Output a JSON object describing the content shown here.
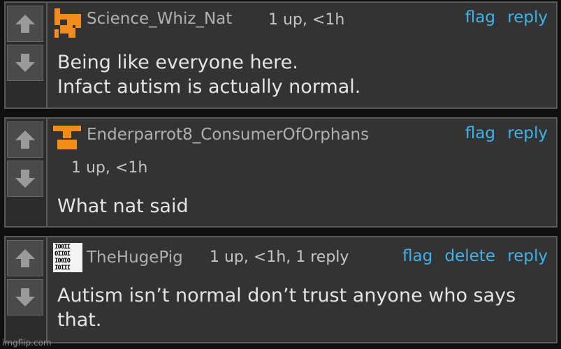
{
  "comments": [
    {
      "username": "Science_Whiz_Nat",
      "meta": "1 up, <1h",
      "flag_label": "flag",
      "reply_label": "reply",
      "text_lines": [
        "Being like everyone here.",
        "Infact autism is actually normal."
      ],
      "avatar_icon": "orange-pixel-avatar-icon"
    },
    {
      "username": "Enderparrot8_ConsumerOfOrphans",
      "meta": "1 up, <1h",
      "flag_label": "flag",
      "reply_label": "reply",
      "text_lines": [
        "What nat said"
      ],
      "avatar_icon": "orange-pixel-avatar-icon"
    },
    {
      "username": "TheHugePig",
      "meta": "1 up, <1h, 1 reply",
      "flag_label": "flag",
      "delete_label": "delete",
      "reply_label": "reply",
      "text_lines": [
        "Autism isn’t normal don’t trust anyone who says",
        "that."
      ],
      "avatar_icon": "binary-avatar-icon",
      "avatar_binary": [
        "I00II",
        "0II0I",
        "I00I0",
        "I0III"
      ]
    }
  ],
  "watermark": "imgflip.com",
  "colors": {
    "link": "#3fb2e8",
    "avatar_orange": "#f28c1e",
    "text": "#e4e4e4",
    "meta": "#c4c4c4",
    "username": "#b0b0b0"
  }
}
